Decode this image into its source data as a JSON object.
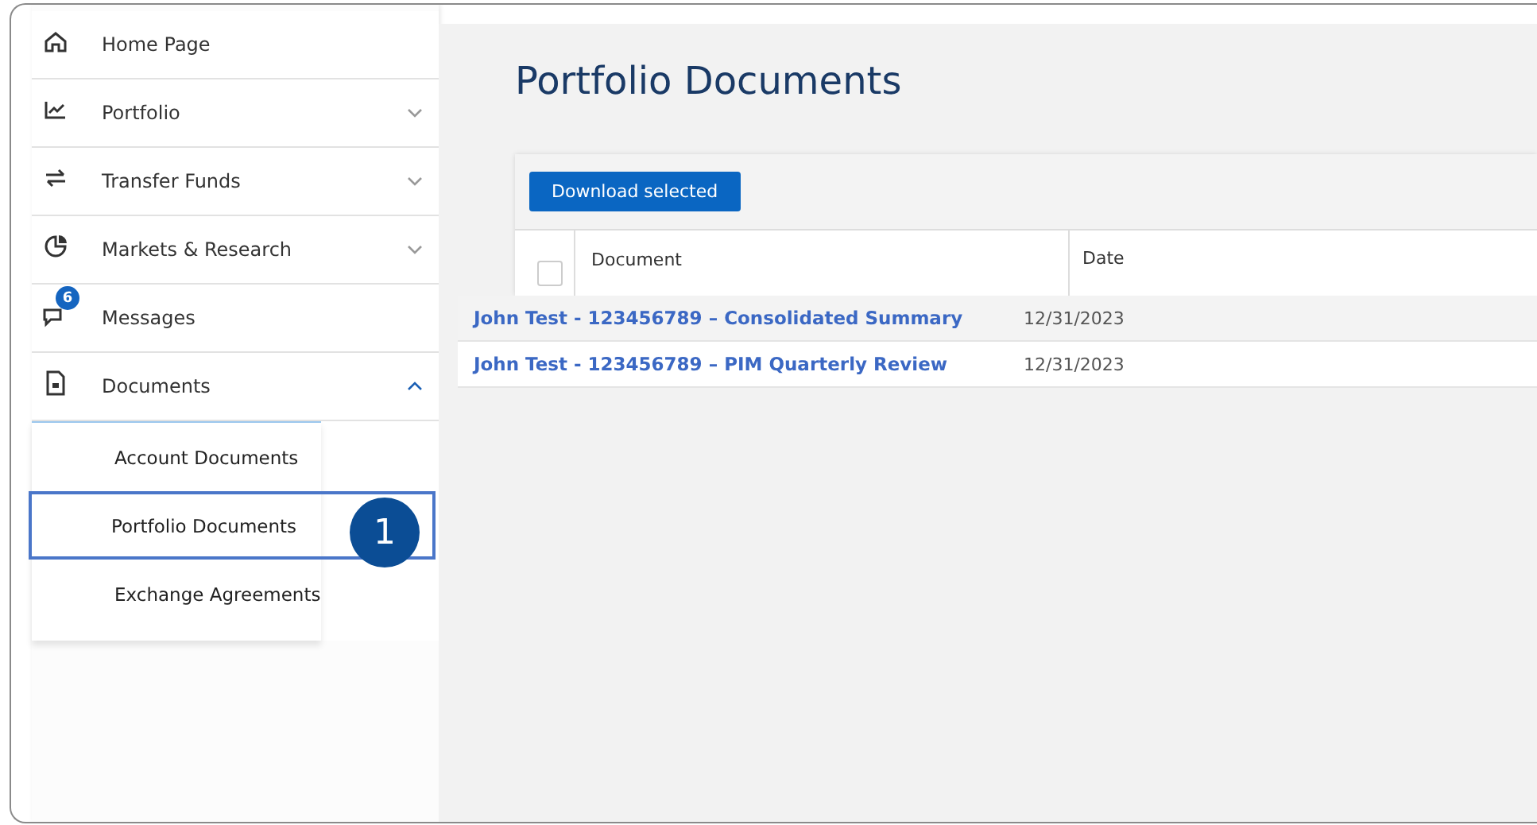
{
  "sidebar": {
    "items": [
      {
        "kind": "home",
        "label": "Home Page",
        "expandable": false
      },
      {
        "kind": "chart",
        "label": "Portfolio",
        "expandable": true,
        "expanded": false
      },
      {
        "kind": "transfer",
        "label": "Transfer Funds",
        "expandable": true,
        "expanded": false
      },
      {
        "kind": "pie",
        "label": "Markets & Research",
        "expandable": true,
        "expanded": false
      },
      {
        "kind": "chat",
        "label": "Messages",
        "badge": "6",
        "expandable": false
      },
      {
        "kind": "doc",
        "label": "Documents",
        "expandable": true,
        "expanded": true,
        "children": [
          {
            "label": "Account Documents",
            "highlighted": false
          },
          {
            "label": "Portfolio Documents",
            "highlighted": true,
            "callout": "1"
          },
          {
            "label": "Exchange Agreements",
            "highlighted": false
          }
        ]
      }
    ]
  },
  "page": {
    "title": "Portfolio Documents",
    "download_button": "Download selected",
    "table": {
      "select_all_checked": false,
      "columns": [
        "Document",
        "Date"
      ],
      "rows": [
        {
          "document": "John Test  - 123456789 – Consolidated Summary",
          "date": "12/31/2023"
        },
        {
          "document": "John Test  - 123456789 – PIM Quarterly Review",
          "date": "12/31/2023"
        }
      ]
    }
  }
}
